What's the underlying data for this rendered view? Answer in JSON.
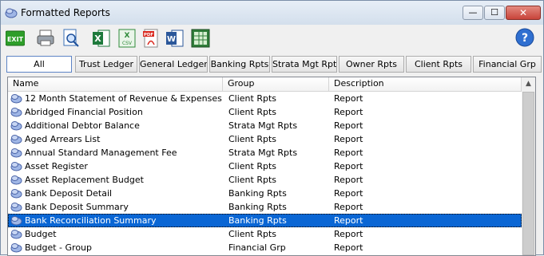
{
  "window": {
    "title": "Formatted Reports"
  },
  "toolbar": {
    "exit_label": "EXIT",
    "csv_label": "CSV",
    "pdf_label": "PDF"
  },
  "tabs": [
    {
      "label": "All"
    },
    {
      "label": "Trust Ledger"
    },
    {
      "label": "General Ledger"
    },
    {
      "label": "Banking Rpts"
    },
    {
      "label": "Strata Mgt Rpts"
    },
    {
      "label": "Owner Rpts"
    },
    {
      "label": "Client Rpts"
    },
    {
      "label": "Financial Grp"
    }
  ],
  "list": {
    "columns": [
      "Name",
      "Group",
      "Description"
    ],
    "rows": [
      {
        "name": "12 Month Statement of Revenue & Expenses",
        "group": "Client Rpts",
        "description": "Report"
      },
      {
        "name": "Abridged Financial Position",
        "group": "Client Rpts",
        "description": "Report"
      },
      {
        "name": "Additional Debtor Balance",
        "group": "Strata Mgt Rpts",
        "description": "Report"
      },
      {
        "name": "Aged Arrears List",
        "group": "Client Rpts",
        "description": "Report"
      },
      {
        "name": "Annual Standard Management Fee",
        "group": "Strata Mgt Rpts",
        "description": "Report"
      },
      {
        "name": "Asset Register",
        "group": "Client Rpts",
        "description": "Report"
      },
      {
        "name": "Asset Replacement Budget",
        "group": "Client Rpts",
        "description": "Report"
      },
      {
        "name": "Bank Deposit Detail",
        "group": "Banking Rpts",
        "description": "Report"
      },
      {
        "name": "Bank Deposit Summary",
        "group": "Banking Rpts",
        "description": "Report"
      },
      {
        "name": "Bank Reconciliation Summary",
        "group": "Banking Rpts",
        "description": "Report"
      },
      {
        "name": "Budget",
        "group": "Client Rpts",
        "description": "Report"
      },
      {
        "name": "Budget - Group",
        "group": "Financial Grp",
        "description": "Report"
      }
    ],
    "selected_index": 9
  },
  "colors": {
    "selection": "#0a66d4",
    "exit_green": "#2e9e2a"
  }
}
